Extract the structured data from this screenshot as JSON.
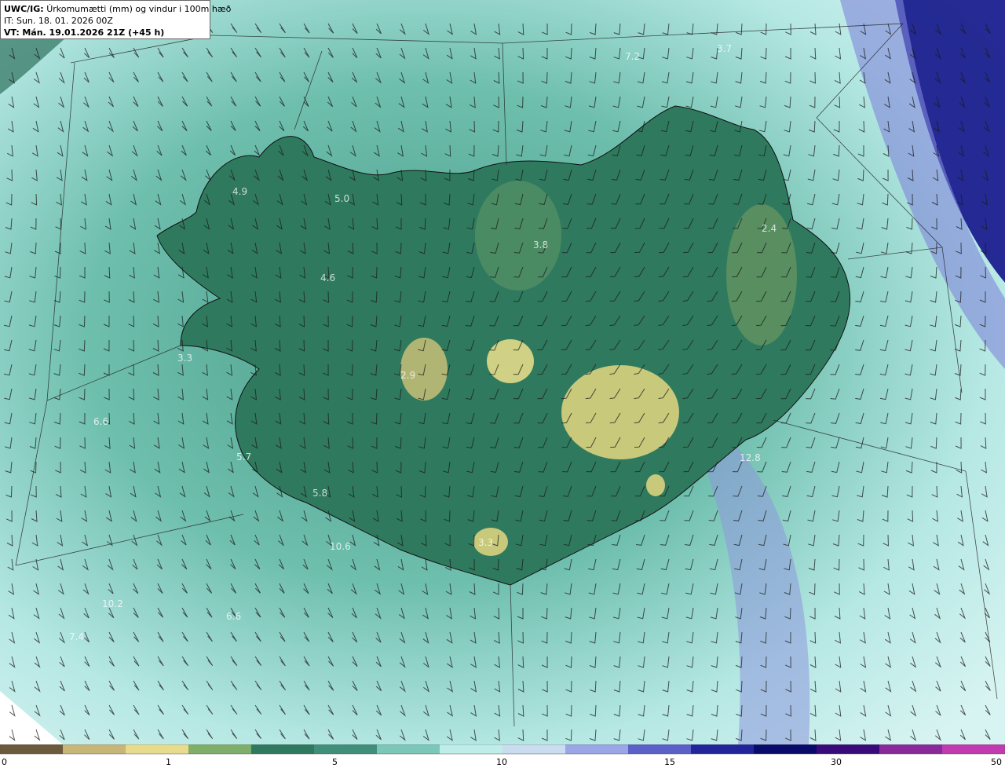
{
  "header": {
    "model_code": "UWC/IG:",
    "title": "Úrkomumætti (mm) og vindur i 100m hæð",
    "it_prefix": "IT:",
    "it_value": "Sun. 18. 01. 2026 00Z",
    "vt_prefix": "VT:",
    "vt_value": "Mán. 19.01.2026 21Z (+45 h)"
  },
  "map_values": [
    "7.2",
    "3.7",
    "4.9",
    "5.0",
    "3.8",
    "2.4",
    "4.6",
    "3.3",
    "2.9",
    "6.6",
    "5.7",
    "5.8",
    "12.8",
    "3.3",
    "6.6",
    "7.4",
    "10.2",
    "10.6"
  ],
  "colorbar": {
    "ticks": [
      "0",
      "1",
      "5",
      "10",
      "15",
      "30",
      "50"
    ],
    "colors": [
      "#6b5a3c",
      "#c7b678",
      "#e8dc8c",
      "#7fae6a",
      "#2f7a5e",
      "#3f8f7a",
      "#7cc8b8",
      "#bfeeea",
      "#c9dcf0",
      "#9aa6e6",
      "#5b5fc8",
      "#22249a",
      "#0a0a6a",
      "#3a0a7a",
      "#8a2a9a",
      "#c23ab0"
    ]
  }
}
